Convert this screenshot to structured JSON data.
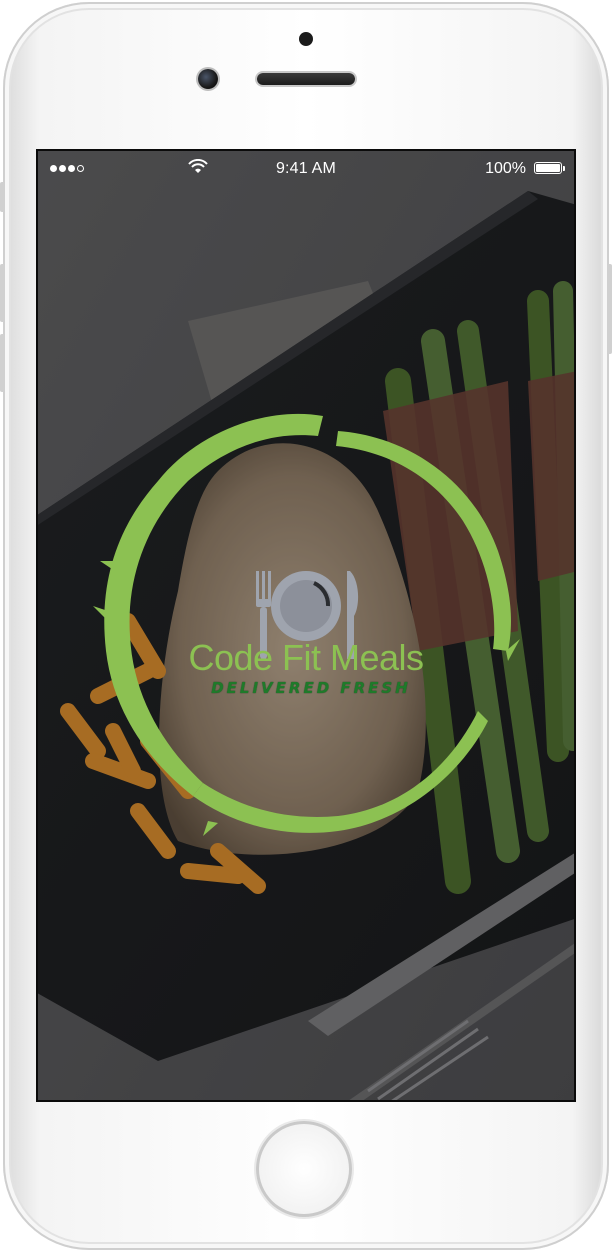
{
  "status_bar": {
    "time": "9:41 AM",
    "battery_percent": "100%",
    "signal_icon": "signal-dots-icon",
    "wifi_icon": "wifi-icon",
    "battery_icon": "battery-icon"
  },
  "splash": {
    "brand_name": "Code Fit Meals",
    "tagline": "Delivered Fresh",
    "logo_icon": "plate-fork-knife-icon",
    "background": "meal-photo-chicken-asparagus-carrots"
  },
  "colors": {
    "brand_green": "#8cc152",
    "tagline_green": "#1f7a2a",
    "plate_gray": "#9fa4ae"
  }
}
